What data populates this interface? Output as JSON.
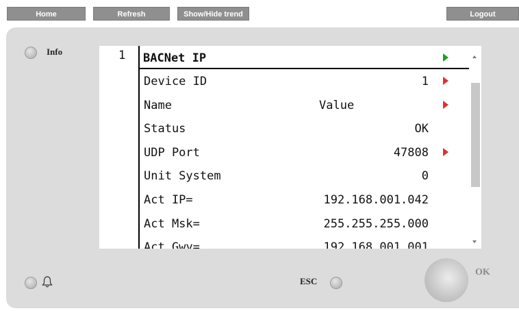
{
  "toolbar": {
    "home": "Home",
    "refresh": "Refresh",
    "show_hide_trend": "Show/Hide trend",
    "logout": "Logout"
  },
  "panel": {
    "info_label": "Info",
    "esc_label": "ESC",
    "ok_label": "OK"
  },
  "screen": {
    "line_number": "1",
    "title": "BACNet IP",
    "rows": [
      {
        "label": "Device ID",
        "value": "1",
        "arrow": true
      },
      {
        "label": "Name",
        "value": "Value",
        "arrow": true
      },
      {
        "label": "Status",
        "value": "OK",
        "arrow": false
      },
      {
        "label": "UDP Port",
        "value": "47808",
        "arrow": true
      },
      {
        "label": "Unit System",
        "value": "0",
        "arrow": false
      },
      {
        "label": "Act IP=",
        "value": "192.168.001.042",
        "arrow": false
      },
      {
        "label": "Act Msk=",
        "value": "255.255.255.000",
        "arrow": false
      },
      {
        "label": "Act Gwy=",
        "value": "192.168.001.001",
        "arrow": false
      }
    ]
  },
  "colors": {
    "arrow_red": "#e03030",
    "arrow_green": "#1ea01e",
    "button_gray": "#8f8f8f",
    "panel_gray": "#dcdcdc"
  },
  "icons": {
    "title_arrow": "play-right-green-icon",
    "row_arrow": "play-right-red-icon",
    "alarm": "bell-icon"
  }
}
